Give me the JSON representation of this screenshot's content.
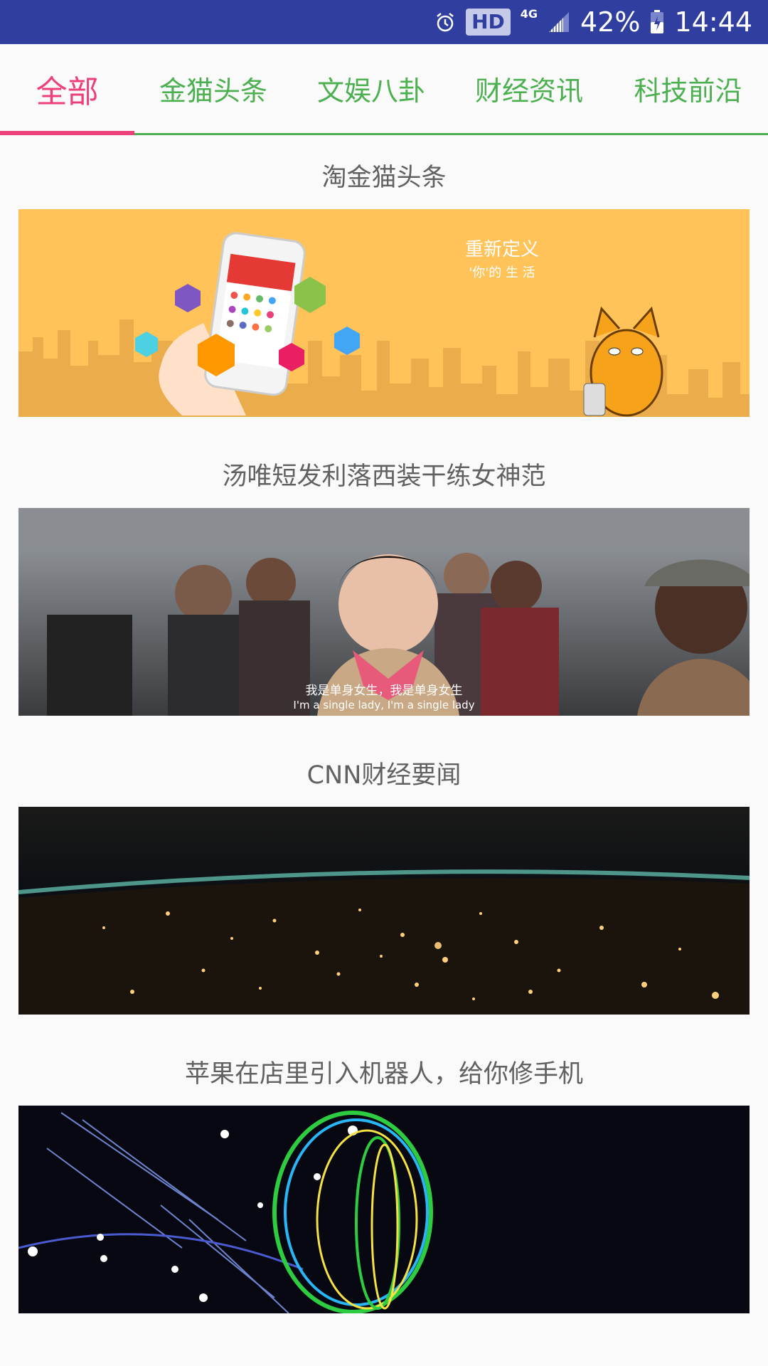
{
  "status_bar": {
    "hd_label": "HD",
    "network_label": "4G",
    "battery_percent": "42%",
    "time": "14:44",
    "icons": [
      "alarm-icon",
      "signal-icon",
      "battery-charging-icon"
    ]
  },
  "tabs": [
    {
      "label": "全部",
      "active": true
    },
    {
      "label": "金猫头条",
      "active": false
    },
    {
      "label": "文娱八卦",
      "active": false
    },
    {
      "label": "财经资讯",
      "active": false
    },
    {
      "label": "科技前沿",
      "active": false
    }
  ],
  "colors": {
    "status_bar": "#303f9f",
    "tab_active": "#ec407a",
    "tab_inactive": "#4caf50",
    "title_text": "#616161"
  },
  "feed": [
    {
      "title": "淘金猫头条",
      "image": {
        "banner_line1": "重新定义",
        "banner_line2": "'你'的 生 活"
      }
    },
    {
      "title": "汤唯短发利落西装干练女神范",
      "image": {
        "subtitle_cn": "我是单身女生，我是单身女生",
        "subtitle_en": "I'm a single lady, I'm a single lady"
      }
    },
    {
      "title": "CNN财经要闻",
      "image": {}
    },
    {
      "title": "苹果在店里引入机器人，给你修手机",
      "image": {}
    }
  ]
}
